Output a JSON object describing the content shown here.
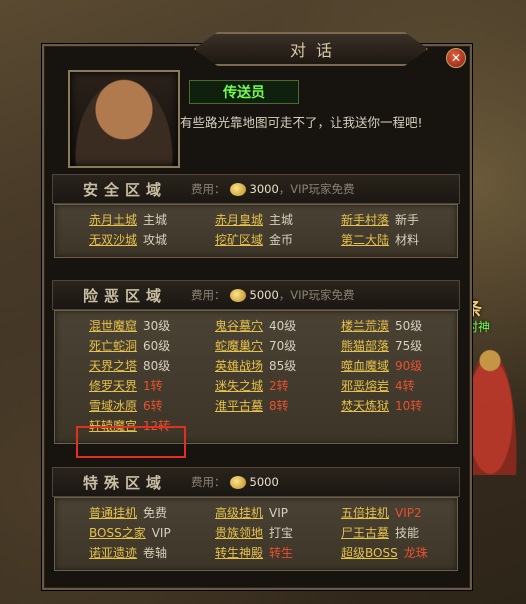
{
  "dialog": {
    "title": "对话",
    "close_icon": "close-icon"
  },
  "npc": {
    "name": "传送员",
    "speech": "有些路光靠地图可走不了，让我送你一程吧!"
  },
  "world": {
    "label": "条",
    "sub": "村神"
  },
  "sections": [
    {
      "title": "安全区域",
      "fee_label": "费用：",
      "fee_amount": "3000",
      "fee_note": "，VIP玩家免费",
      "rows": [
        [
          {
            "name": "赤月土城",
            "tag": "主城",
            "red": false
          },
          {
            "name": "赤月皇城",
            "tag": "主城",
            "red": false
          },
          {
            "name": "新手村落",
            "tag": "新手",
            "red": false
          }
        ],
        [
          {
            "name": "无双沙城",
            "tag": "攻城",
            "red": false
          },
          {
            "name": "挖矿区域",
            "tag": "金币",
            "red": false
          },
          {
            "name": "第二大陆",
            "tag": "材料",
            "red": false
          }
        ]
      ]
    },
    {
      "title": "险恶区域",
      "fee_label": "费用：",
      "fee_amount": "5000",
      "fee_note": "，VIP玩家免费",
      "rows": [
        [
          {
            "name": "混世魔窟",
            "tag": "30级",
            "red": false
          },
          {
            "name": "鬼谷墓穴",
            "tag": "40级",
            "red": false
          },
          {
            "name": "楼兰荒漠",
            "tag": "50级",
            "red": false
          }
        ],
        [
          {
            "name": "死亡蛇洞",
            "tag": "60级",
            "red": false
          },
          {
            "name": "蛇魔巢穴",
            "tag": "70级",
            "red": false
          },
          {
            "name": "熊猫部落",
            "tag": "75级",
            "red": false
          }
        ],
        [
          {
            "name": "天界之塔",
            "tag": "80级",
            "red": false
          },
          {
            "name": "英雄战场",
            "tag": "85级",
            "red": false
          },
          {
            "name": "噬血魔域",
            "tag": "90级",
            "red": true
          }
        ],
        [
          {
            "name": "修罗天界",
            "tag": "1转",
            "red": true
          },
          {
            "name": "迷失之城",
            "tag": "2转",
            "red": true
          },
          {
            "name": "邪恶熔岩",
            "tag": "4转",
            "red": true
          }
        ],
        [
          {
            "name": "雪域冰原",
            "tag": "6转",
            "red": true
          },
          {
            "name": "淮平古墓",
            "tag": "8转",
            "red": true
          },
          {
            "name": "焚天炼狱",
            "tag": "10转",
            "red": true
          }
        ],
        [
          {
            "name": "轩辕魔宫",
            "tag": "12转",
            "red": true
          }
        ]
      ]
    },
    {
      "title": "特殊区域",
      "fee_label": "费用：",
      "fee_amount": "5000",
      "fee_note": "",
      "rows": [
        [
          {
            "name": "普通挂机",
            "tag": "免费",
            "red": false
          },
          {
            "name": "高级挂机",
            "tag": "VIP",
            "red": false
          },
          {
            "name": "五倍挂机",
            "tag": "VIP2",
            "red": true
          }
        ],
        [
          {
            "name": "BOSS之家",
            "tag": "VIP",
            "red": false
          },
          {
            "name": "贵族领地",
            "tag": "打宝",
            "red": false
          },
          {
            "name": "尸王古墓",
            "tag": "技能",
            "red": false
          }
        ],
        [
          {
            "name": "诺亚遗迹",
            "tag": "卷轴",
            "red": false
          },
          {
            "name": "转生神殿",
            "tag": "转生",
            "red": true
          },
          {
            "name": "超级BOSS",
            "tag": "龙珠",
            "red": true
          }
        ]
      ]
    }
  ]
}
